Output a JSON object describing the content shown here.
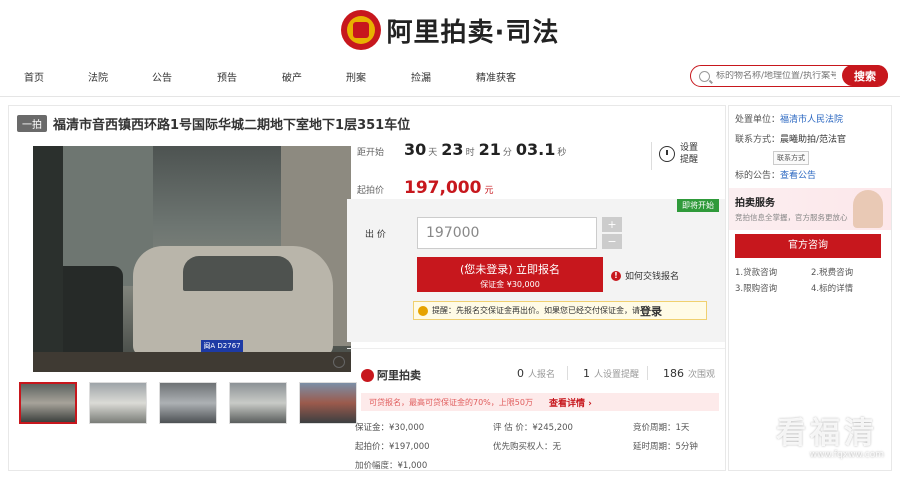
{
  "header": {
    "logo_text": "阿里拍卖·司法"
  },
  "nav": {
    "items": [
      "首页",
      "法院",
      "公告",
      "预告",
      "破产",
      "刑案",
      "捡漏",
      "精准获客"
    ],
    "search_placeholder": "标的物名称/地理位置/执行案号",
    "search_button": "搜索"
  },
  "item": {
    "tag": "一拍",
    "title": "福清市音西镇西环路1号国际华城二期地下室地下1层351车位"
  },
  "countdown": {
    "label": "距开始",
    "days": "30",
    "days_unit": "天",
    "hours": "23",
    "hours_unit": "时",
    "minutes": "21",
    "minutes_unit": "分",
    "seconds": "03.1",
    "seconds_unit": "秒"
  },
  "remind": {
    "label": "设置提醒"
  },
  "start_price": {
    "label": "起拍价",
    "value": "197,000",
    "unit": "元"
  },
  "photo": {
    "plate_text": "闽A D2767"
  },
  "bid": {
    "badge": "即将开始",
    "label": "出 价",
    "value": "197000",
    "plus": "+",
    "minus": "−",
    "register_main": "(您未登录) 立即报名",
    "register_sub": "保证金 ¥30,000",
    "how_pay": "如何交钱报名",
    "tip_text": "提醒：先报名交保证金再出价。如果您已经交付保证金，请",
    "tip_link": "登录"
  },
  "stats": {
    "logo_text": "阿里拍卖",
    "applicants": "0",
    "applicants_label": "人报名",
    "reminders": "1",
    "reminders_label": "人设置提醒",
    "views": "186",
    "views_label": "次围观",
    "loan_text": "可贷报名，最高可贷保证金的70%，上限50万",
    "loan_link": "查看详情 ›"
  },
  "info": [
    [
      "保证金：¥30,000",
      "评 估 价：¥245,200",
      "竞价周期：1天"
    ],
    [
      "起拍价：¥197,000",
      "优先购买权人：无",
      "延时周期：5分钟"
    ],
    [
      "加价幅度：¥1,000",
      "",
      ""
    ]
  ],
  "sidebar": {
    "unit_label": "处置单位：",
    "unit_value": "福清市人民法院",
    "contact_label": "联系方式：",
    "contact_value": "晨曦助拍/范法官",
    "contact_btn": "联系方式",
    "notice_label": "标的公告：",
    "notice_link": "查看公告",
    "service_title": "拍卖服务",
    "service_sub": "竞拍信息全掌握，官方服务更放心",
    "consult_btn": "官方咨询",
    "items": [
      "1.贷款咨询",
      "2.税费咨询",
      "3.限购咨询",
      "4.标的详情"
    ]
  },
  "watermark": {
    "text": "看福清",
    "url": "www.fqxww.com"
  }
}
